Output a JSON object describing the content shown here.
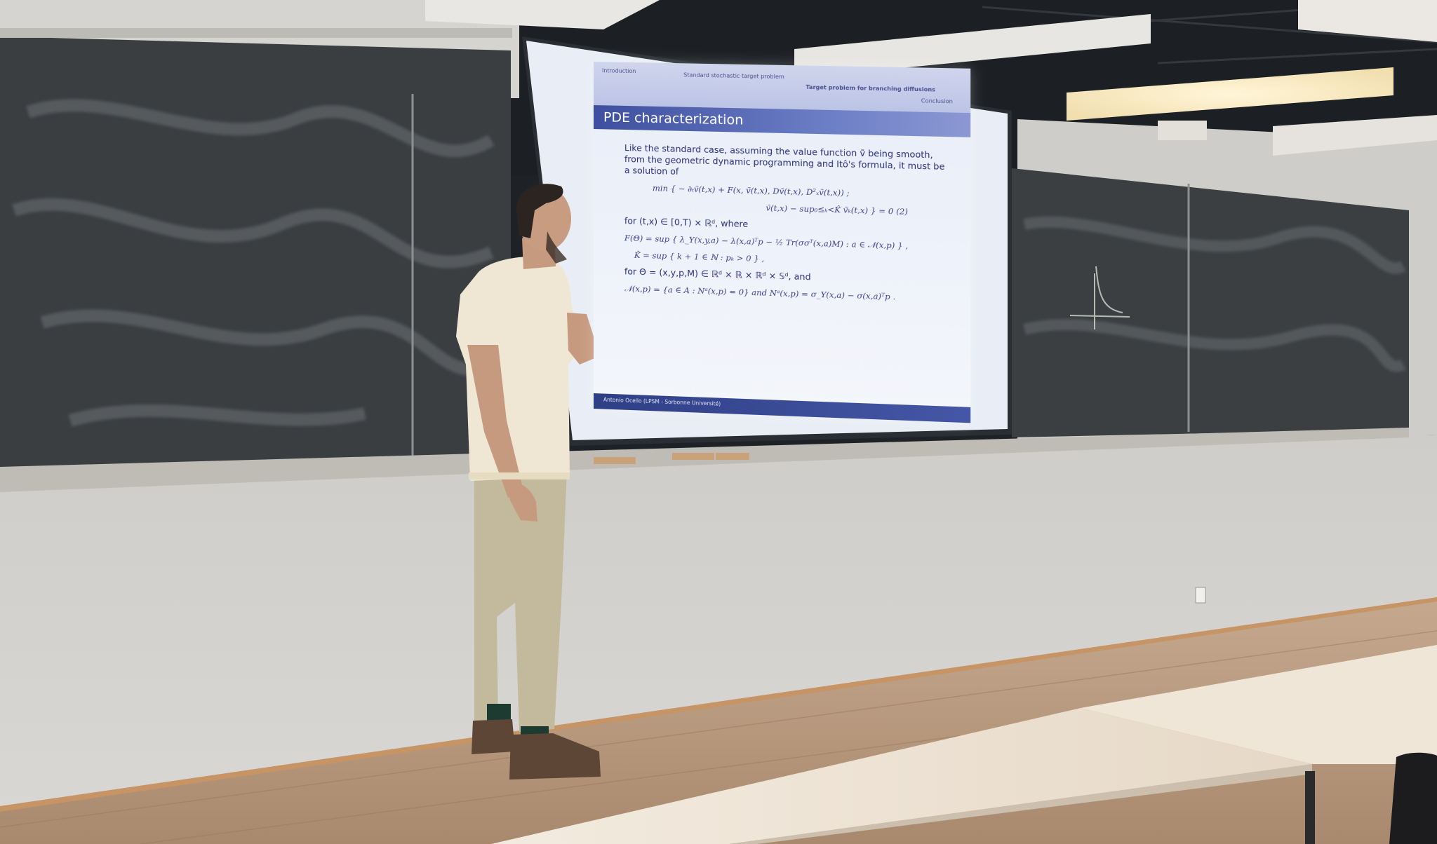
{
  "slide": {
    "nav": {
      "section_1": "Introduction",
      "section_2": "Standard stochastic target problem",
      "section_3": "Target problem for branching diffusions",
      "section_4": "Conclusion"
    },
    "title": "PDE characterization",
    "intro": "Like the standard case, assuming the value function ṽ being smooth, from the geometric dynamic programming and Itô's formula, it must be a solution of",
    "eq_min": "min { − ∂ₜṽ(t,x) + F(x, ṽ(t,x), Dṽ(t,x), D²ₓṽ(t,x)) ;",
    "eq_second": "ṽ(t,x) − sup₀≤ₖ<K̂ ṽₖ(t,x) }  =  0   (2)",
    "for_text": "for (t,x) ∈ [0,T) × ℝᵈ, where",
    "eq_F": "F(Θ)  =  sup { λ_Y(x,y,a) − λ(x,a)ᵀp − ½ Tr(σσᵀ(x,a)M) : a ∈ 𝒩(x,p) } ,",
    "eq_K": "K̂  =  sup { k + 1 ∈ ℕ : pₖ > 0 } ,",
    "theta_text": "for Θ = (x,y,p,M) ∈ ℝᵈ × ℝ × ℝᵈ × 𝕊ᵈ, and",
    "eq_N": "𝒩(x,p) = {a ∈ A : Nᵃ(x,p) = 0}  and  Nᵃ(x,p) = σ_Y(x,a) − σ(x,a)ᵀp .",
    "footer": "Antonio Ocello (LPSM - Sorbonne Université)"
  },
  "colors": {
    "wall": "#d4d2cf",
    "chalkboard": "#3b3f42",
    "slide_title_bar": "#3d4f9e",
    "floor": "#b79b82",
    "table": "#efe4d6",
    "shirt": "#efe7d3",
    "trousers": "#c4bb9e"
  }
}
